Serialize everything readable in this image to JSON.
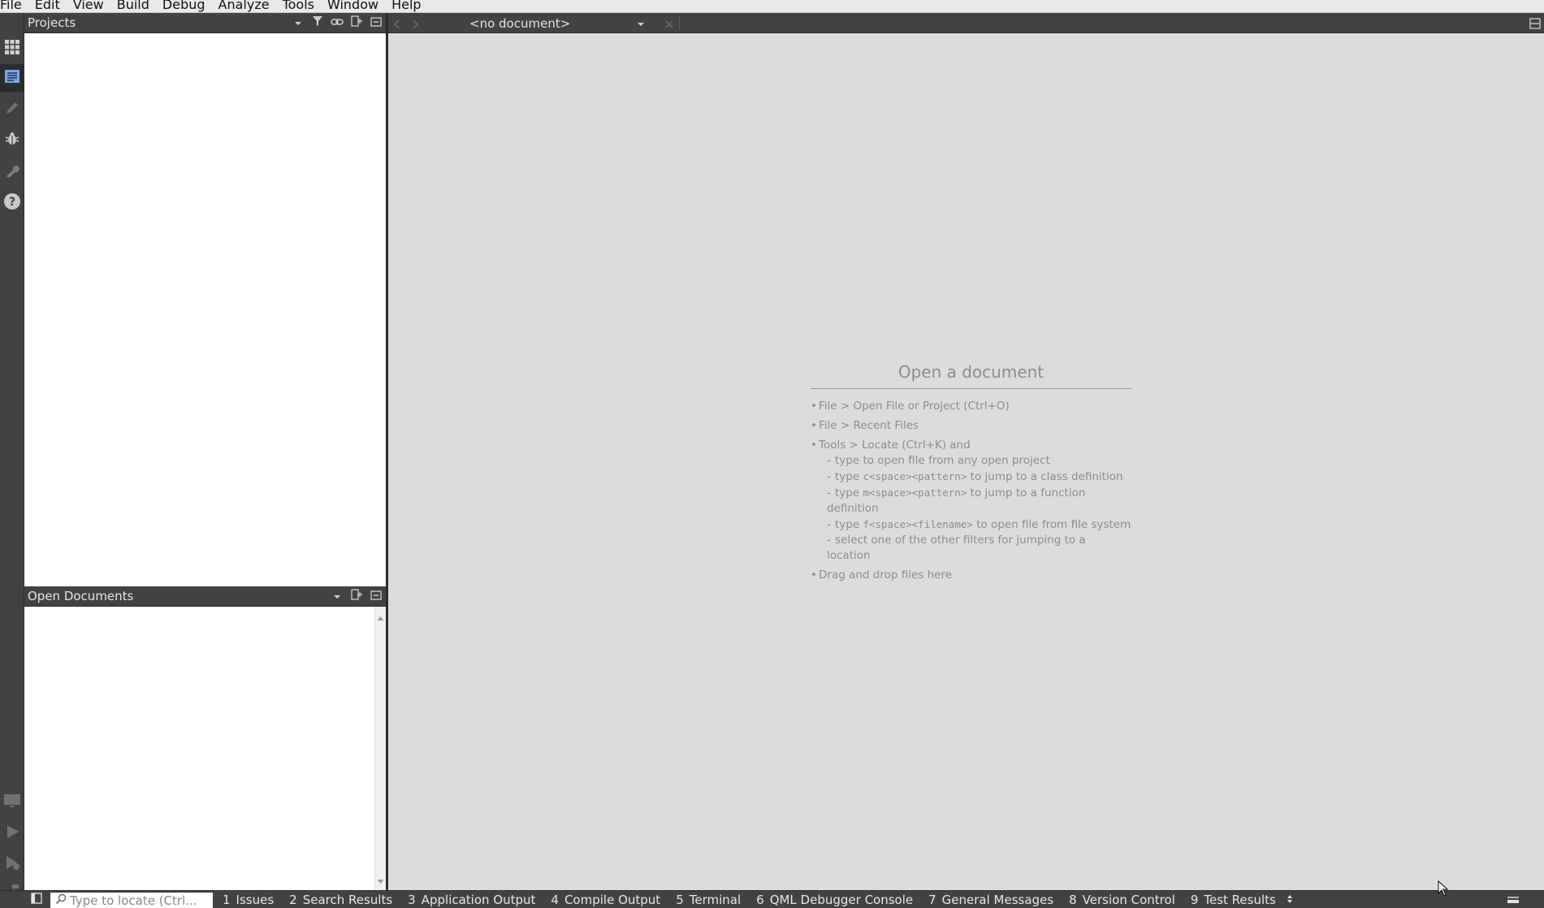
{
  "menubar": {
    "items": [
      "File",
      "Edit",
      "View",
      "Build",
      "Debug",
      "Analyze",
      "Tools",
      "Window",
      "Help"
    ]
  },
  "modebar": {
    "modes": [
      {
        "icon": "welcome-grid-icon",
        "active": false
      },
      {
        "icon": "edit-document-icon",
        "active": true
      },
      {
        "icon": "design-pencil-icon",
        "active": false
      },
      {
        "icon": "debug-bug-icon",
        "active": false
      },
      {
        "icon": "projects-wrench-icon",
        "active": false
      },
      {
        "icon": "help-question-icon",
        "active": false
      }
    ],
    "bottom": [
      {
        "icon": "kit-selector-monitor-icon"
      },
      {
        "icon": "run-icon"
      },
      {
        "icon": "debug-run-icon"
      },
      {
        "icon": "build-hammer-icon"
      }
    ]
  },
  "projects_pane": {
    "title": "Projects"
  },
  "open_documents_pane": {
    "title": "Open Documents"
  },
  "editor": {
    "document_combo": "<no document>",
    "placeholder": {
      "title": "Open a document",
      "items": [
        "File > Open File or Project (Ctrl+O)",
        "File > Recent Files",
        "Tools > Locate (Ctrl+K) and",
        "Drag and drop files here"
      ],
      "locate_hints": {
        "line1": "type to open file from any open project",
        "line2_pre": "type ",
        "line2_code": "c<space><pattern>",
        "line2_post": " to jump to a class definition",
        "line3_pre": "type ",
        "line3_code": "m<space><pattern>",
        "line3_post": " to jump to a function definition",
        "line4_pre": "type ",
        "line4_code": "f<space><filename>",
        "line4_post": " to open file from file system",
        "line5": "select one of the other filters for jumping to a location"
      }
    }
  },
  "statusbar": {
    "locator_placeholder": "Type to locate (Ctrl...",
    "output_tabs": [
      {
        "num": "1",
        "label": "Issues"
      },
      {
        "num": "2",
        "label": "Search Results"
      },
      {
        "num": "3",
        "label": "Application Output"
      },
      {
        "num": "4",
        "label": "Compile Output"
      },
      {
        "num": "5",
        "label": "Terminal"
      },
      {
        "num": "6",
        "label": "QML Debugger Console"
      },
      {
        "num": "7",
        "label": "General Messages"
      },
      {
        "num": "8",
        "label": "Version Control"
      },
      {
        "num": "9",
        "label": "Test Results"
      }
    ]
  },
  "colors": {
    "chrome": "#404244",
    "editor_bg": "#dcdcdc",
    "pane_bg": "#ffffff",
    "placeholder_text": "#8c8c8c",
    "active_mode_accent": "#7aa6e8"
  }
}
